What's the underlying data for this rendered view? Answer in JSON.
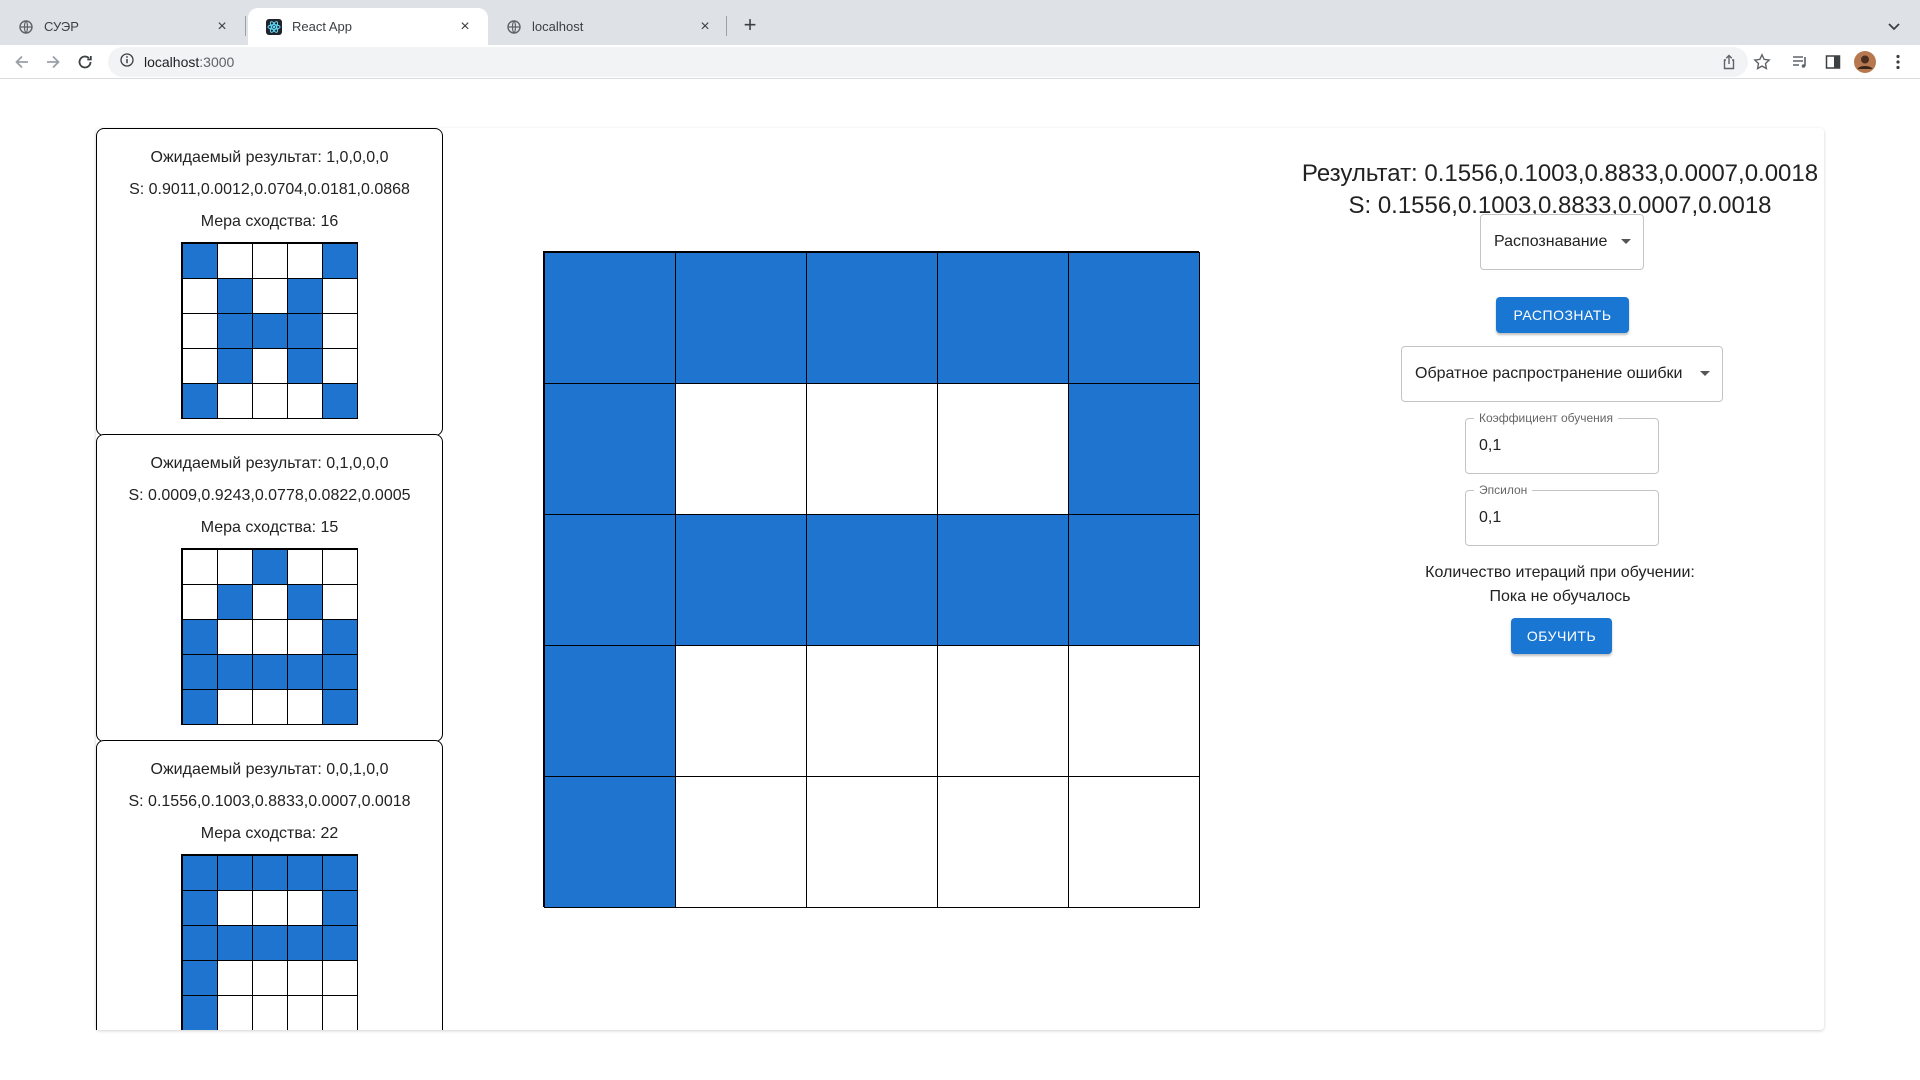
{
  "browser": {
    "tabs": [
      {
        "title": "СУЭР",
        "icon": "globe-icon",
        "active": false
      },
      {
        "title": "React App",
        "icon": "react-icon",
        "active": true
      },
      {
        "title": "localhost",
        "icon": "globe-icon",
        "active": false
      }
    ],
    "address": {
      "host": "localhost",
      "port": ":3000"
    }
  },
  "samples": [
    {
      "expected": "Ожидаемый результат: 1,0,0,0,0",
      "s": "S: 0.9011,0.0012,0.0704,0.0181,0.0868",
      "similarity": "Мера сходства: 16",
      "grid": [
        [
          1,
          0,
          0,
          0,
          1
        ],
        [
          0,
          1,
          0,
          1,
          0
        ],
        [
          0,
          1,
          1,
          1,
          0
        ],
        [
          0,
          1,
          0,
          1,
          0
        ],
        [
          1,
          0,
          0,
          0,
          1
        ]
      ]
    },
    {
      "expected": "Ожидаемый результат: 0,1,0,0,0",
      "s": "S: 0.0009,0.9243,0.0778,0.0822,0.0005",
      "similarity": "Мера сходства: 15",
      "grid": [
        [
          0,
          0,
          1,
          0,
          0
        ],
        [
          0,
          1,
          0,
          1,
          0
        ],
        [
          1,
          0,
          0,
          0,
          1
        ],
        [
          1,
          1,
          1,
          1,
          1
        ],
        [
          1,
          0,
          0,
          0,
          1
        ]
      ]
    },
    {
      "expected": "Ожидаемый результат: 0,0,1,0,0",
      "s": "S: 0.1556,0.1003,0.8833,0.0007,0.0018",
      "similarity": "Мера сходства: 22",
      "grid": [
        [
          1,
          1,
          1,
          1,
          1
        ],
        [
          1,
          0,
          0,
          0,
          1
        ],
        [
          1,
          1,
          1,
          1,
          1
        ],
        [
          1,
          0,
          0,
          0,
          0
        ],
        [
          1,
          0,
          0,
          0,
          0
        ]
      ]
    }
  ],
  "canvas": {
    "grid": [
      [
        1,
        1,
        1,
        1,
        1
      ],
      [
        1,
        0,
        0,
        0,
        1
      ],
      [
        1,
        1,
        1,
        1,
        1
      ],
      [
        1,
        0,
        0,
        0,
        0
      ],
      [
        1,
        0,
        0,
        0,
        0
      ]
    ],
    "on_color": "#1e74cf"
  },
  "panel": {
    "result": "Результат: 0.1556,0.1003,0.8833,0.0007,0.0018",
    "s": "S: 0.1556,0.1003,0.8833,0.0007,0.0018",
    "mode_select": "Распознавание",
    "recognize_button": "РАСПОЗНАТЬ",
    "method_select": "Обратное распространение ошибки",
    "learning_rate": {
      "label": "Коэффициент обучения",
      "value": "0,1"
    },
    "epsilon": {
      "label": "Эпсилон",
      "value": "0,1"
    },
    "iterations_label": "Количество итераций при обучении:",
    "iterations_value": "Пока не обучалось",
    "train_button": "ОБУЧИТЬ",
    "accent": "#1976d2"
  }
}
